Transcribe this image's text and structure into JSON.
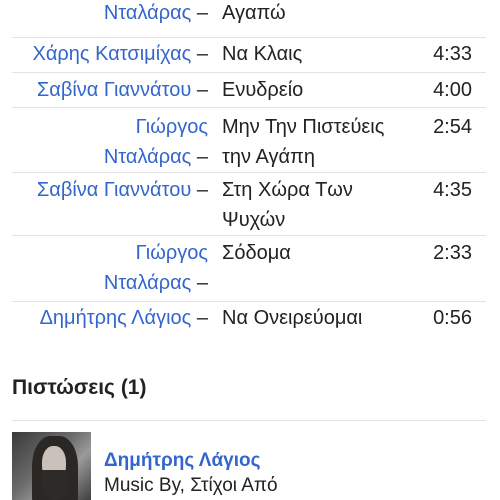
{
  "tracks": [
    {
      "artist_line1": "",
      "artist_line2": "Νταλάρας",
      "title_line1": "Αγαπώ",
      "title_line2": "",
      "duration": ""
    },
    {
      "artist_line1": "Χάρης Κατσιμίχας",
      "artist_line2": "",
      "title_line1": "Να Κλαις",
      "title_line2": "",
      "duration": "4:33"
    },
    {
      "artist_line1": "Σαβίνα Γιαννάτου",
      "artist_line2": "",
      "title_line1": "Ενυδρείο",
      "title_line2": "",
      "duration": "4:00"
    },
    {
      "artist_line1": "Γιώργος",
      "artist_line2": "Νταλάρας",
      "title_line1": "Μην Την Πιστεύεις",
      "title_line2": "την Αγάπη",
      "duration": "2:54"
    },
    {
      "artist_line1": "Σαβίνα Γιαννάτου",
      "artist_line2": "",
      "title_line1": "Στη Χώρα Των",
      "title_line2": "Ψυχών",
      "duration": "4:35"
    },
    {
      "artist_line1": "Γιώργος",
      "artist_line2": "Νταλάρας",
      "title_line1": "Σόδομα",
      "title_line2": "",
      "duration": "2:33"
    },
    {
      "artist_line1": "Δημήτρης Λάγιος",
      "artist_line2": "",
      "title_line1": "Να Ονειρεύομαι",
      "title_line2": "",
      "duration": "0:56"
    }
  ],
  "dash": "–",
  "credits": {
    "title": "Πιστώσεις (1)",
    "items": [
      {
        "name": "Δημήτρης Λάγιος",
        "role": "Music By, Στίχοι Από"
      }
    ]
  }
}
